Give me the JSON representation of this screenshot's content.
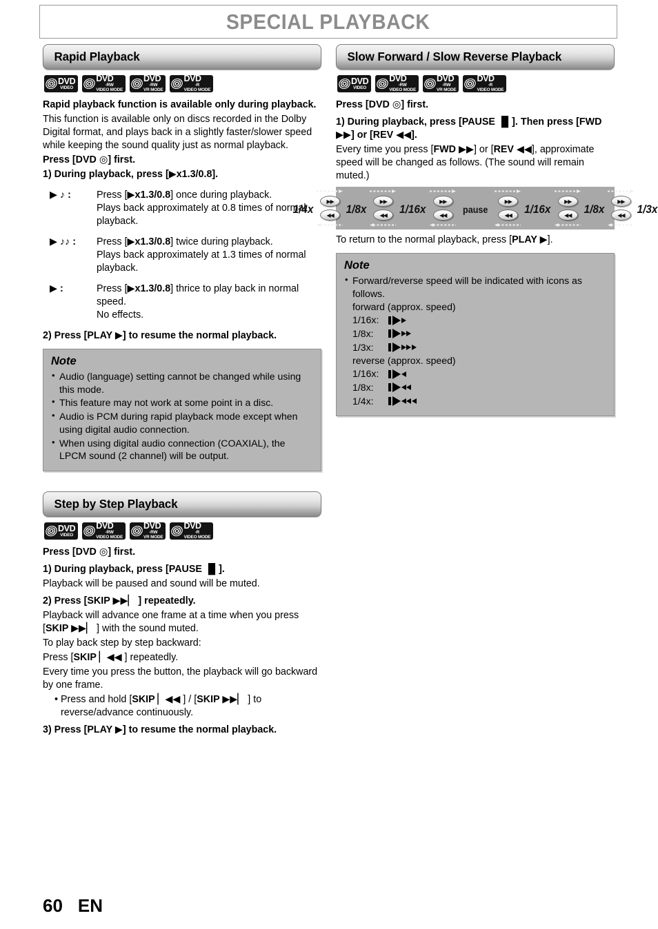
{
  "page": {
    "title": "SPECIAL PLAYBACK",
    "number": "60",
    "lang": "EN"
  },
  "badges": {
    "dvd_video": {
      "t1": "DVD",
      "t2": "",
      "t3": "VIDEO"
    },
    "dvd_rw_video": {
      "t1": "DVD",
      "t2": "-RW",
      "t3": "VIDEO MODE"
    },
    "dvd_rw_vr": {
      "t1": "DVD",
      "t2": "-RW",
      "t3": "VR MODE"
    },
    "dvd_r_video": {
      "t1": "DVD",
      "t2": "-R",
      "t3": "VIDEO MODE"
    }
  },
  "rapid": {
    "heading": "Rapid Playback",
    "lead_bold": "Rapid playback function is available only during playback.",
    "intro": "This function is available only on discs recorded in the Dolby Digital format, and plays back in a slightly faster/slower speed while keeping the sound quality just as normal playback.",
    "press_dvd_pre": "Press [DVD ",
    "press_dvd_post": "] first.",
    "step1": "1) During playback, press [▶x1.3/0.8].",
    "rows": [
      {
        "key_icons": "▶ ♪ :",
        "line1_a": "Press [",
        "line1_b": "▶x1.3/0.8",
        "line1_c": "] once during playback.",
        "line2": "Plays back approximately at 0.8 times of normal playback."
      },
      {
        "key_icons": "▶ ♪♪ :",
        "line1_a": "Press [",
        "line1_b": "▶x1.3/0.8",
        "line1_c": "] twice during playback.",
        "line2": "Plays back approximately at 1.3 times of normal playback."
      },
      {
        "key_icons": "▶ :",
        "line1_a": "Press [",
        "line1_b": "▶x1.3/0.8",
        "line1_c": "] thrice to play back in normal speed.",
        "line2": "No effects."
      }
    ],
    "step2": "2) Press [PLAY ▶] to resume the normal playback.",
    "note": {
      "title": "Note",
      "items": [
        "Audio (language) setting cannot be changed while using this mode.",
        "This feature may not work at some point in a disc.",
        "Audio is PCM during rapid playback mode except when using digital audio connection.",
        "When using digital audio connection (COAXIAL), the LPCM sound (2 channel) will be output."
      ]
    }
  },
  "stepbystep": {
    "heading": "Step by Step Playback",
    "press_dvd_pre": "Press [DVD ",
    "press_dvd_post": "] first.",
    "step1": "1) During playback, press [PAUSE ▐▌].",
    "step1_sub": "Playback will be paused and sound will be muted.",
    "step2": "2) Press [SKIP ▶▶▏ ] repeatedly.",
    "step2_sub1_a": "Playback will advance one frame at a time when you press [",
    "step2_sub1_b": "SKIP ▶▶▏",
    "step2_sub1_c": " ] with the sound muted.",
    "step2_sub2": "To play back step by step backward:",
    "step2_sub3_a": "Press [",
    "step2_sub3_b": "SKIP ▏◀◀",
    "step2_sub3_c": " ] repeatedly.",
    "step2_sub4": "Every time you press the button, the playback will go backward by one frame.",
    "step2_bullet_a": "Press and hold [",
    "step2_bullet_b": "SKIP ▏◀◀",
    "step2_bullet_c": " ] / [",
    "step2_bullet_d": "SKIP ▶▶▏",
    "step2_bullet_e": " ] to reverse/advance continuously.",
    "step3": "3) Press [PLAY ▶] to resume the normal playback."
  },
  "slow": {
    "heading": "Slow Forward / Slow Reverse Playback",
    "press_dvd_pre": "Press [DVD ",
    "press_dvd_post": "] first.",
    "step1_a": "1) During playback, press [PAUSE ▐▌]. Then press [FWD ▶▶] or [REV ◀◀].",
    "step1_sub_a": "Every time you press [",
    "step1_sub_b": "FWD ▶▶",
    "step1_sub_c": "] or [",
    "step1_sub_d": "REV ◀◀",
    "step1_sub_e": "], approximate speed will be changed as follows. (The sound will remain muted.)",
    "diagram": {
      "labels": [
        "1/4x",
        "1/8x",
        "1/16x",
        "pause",
        "1/16x",
        "1/8x",
        "1/3x"
      ],
      "fwd_icon": "▶▶",
      "rev_icon": "◀◀",
      "units": 6
    },
    "return_a": "To return to the normal playback, press [",
    "return_b": "PLAY ▶",
    "return_c": "].",
    "note": {
      "title": "Note",
      "bullet": "Forward/reverse speed will be indicated with icons as follows.",
      "forward_label": "forward (approx. speed)",
      "forward_rows": [
        {
          "label": "1/16x:",
          "small": 1
        },
        {
          "label": "1/8x:",
          "small": 2
        },
        {
          "label": "1/3x:",
          "small": 3
        }
      ],
      "reverse_label": "reverse (approx. speed)",
      "reverse_rows": [
        {
          "label": "1/16x:",
          "small": 1
        },
        {
          "label": "1/8x:",
          "small": 2
        },
        {
          "label": "1/4x:",
          "small": 3
        }
      ]
    }
  }
}
